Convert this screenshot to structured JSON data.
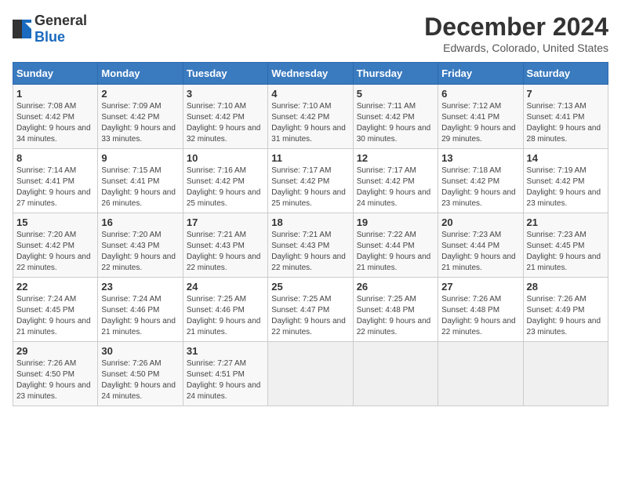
{
  "logo": {
    "text_general": "General",
    "text_blue": "Blue"
  },
  "title": "December 2024",
  "subtitle": "Edwards, Colorado, United States",
  "days_of_week": [
    "Sunday",
    "Monday",
    "Tuesday",
    "Wednesday",
    "Thursday",
    "Friday",
    "Saturday"
  ],
  "weeks": [
    [
      {
        "day": "1",
        "sunrise": "Sunrise: 7:08 AM",
        "sunset": "Sunset: 4:42 PM",
        "daylight": "Daylight: 9 hours and 34 minutes."
      },
      {
        "day": "2",
        "sunrise": "Sunrise: 7:09 AM",
        "sunset": "Sunset: 4:42 PM",
        "daylight": "Daylight: 9 hours and 33 minutes."
      },
      {
        "day": "3",
        "sunrise": "Sunrise: 7:10 AM",
        "sunset": "Sunset: 4:42 PM",
        "daylight": "Daylight: 9 hours and 32 minutes."
      },
      {
        "day": "4",
        "sunrise": "Sunrise: 7:10 AM",
        "sunset": "Sunset: 4:42 PM",
        "daylight": "Daylight: 9 hours and 31 minutes."
      },
      {
        "day": "5",
        "sunrise": "Sunrise: 7:11 AM",
        "sunset": "Sunset: 4:42 PM",
        "daylight": "Daylight: 9 hours and 30 minutes."
      },
      {
        "day": "6",
        "sunrise": "Sunrise: 7:12 AM",
        "sunset": "Sunset: 4:41 PM",
        "daylight": "Daylight: 9 hours and 29 minutes."
      },
      {
        "day": "7",
        "sunrise": "Sunrise: 7:13 AM",
        "sunset": "Sunset: 4:41 PM",
        "daylight": "Daylight: 9 hours and 28 minutes."
      }
    ],
    [
      {
        "day": "8",
        "sunrise": "Sunrise: 7:14 AM",
        "sunset": "Sunset: 4:41 PM",
        "daylight": "Daylight: 9 hours and 27 minutes."
      },
      {
        "day": "9",
        "sunrise": "Sunrise: 7:15 AM",
        "sunset": "Sunset: 4:41 PM",
        "daylight": "Daylight: 9 hours and 26 minutes."
      },
      {
        "day": "10",
        "sunrise": "Sunrise: 7:16 AM",
        "sunset": "Sunset: 4:42 PM",
        "daylight": "Daylight: 9 hours and 25 minutes."
      },
      {
        "day": "11",
        "sunrise": "Sunrise: 7:17 AM",
        "sunset": "Sunset: 4:42 PM",
        "daylight": "Daylight: 9 hours and 25 minutes."
      },
      {
        "day": "12",
        "sunrise": "Sunrise: 7:17 AM",
        "sunset": "Sunset: 4:42 PM",
        "daylight": "Daylight: 9 hours and 24 minutes."
      },
      {
        "day": "13",
        "sunrise": "Sunrise: 7:18 AM",
        "sunset": "Sunset: 4:42 PM",
        "daylight": "Daylight: 9 hours and 23 minutes."
      },
      {
        "day": "14",
        "sunrise": "Sunrise: 7:19 AM",
        "sunset": "Sunset: 4:42 PM",
        "daylight": "Daylight: 9 hours and 23 minutes."
      }
    ],
    [
      {
        "day": "15",
        "sunrise": "Sunrise: 7:20 AM",
        "sunset": "Sunset: 4:42 PM",
        "daylight": "Daylight: 9 hours and 22 minutes."
      },
      {
        "day": "16",
        "sunrise": "Sunrise: 7:20 AM",
        "sunset": "Sunset: 4:43 PM",
        "daylight": "Daylight: 9 hours and 22 minutes."
      },
      {
        "day": "17",
        "sunrise": "Sunrise: 7:21 AM",
        "sunset": "Sunset: 4:43 PM",
        "daylight": "Daylight: 9 hours and 22 minutes."
      },
      {
        "day": "18",
        "sunrise": "Sunrise: 7:21 AM",
        "sunset": "Sunset: 4:43 PM",
        "daylight": "Daylight: 9 hours and 22 minutes."
      },
      {
        "day": "19",
        "sunrise": "Sunrise: 7:22 AM",
        "sunset": "Sunset: 4:44 PM",
        "daylight": "Daylight: 9 hours and 21 minutes."
      },
      {
        "day": "20",
        "sunrise": "Sunrise: 7:23 AM",
        "sunset": "Sunset: 4:44 PM",
        "daylight": "Daylight: 9 hours and 21 minutes."
      },
      {
        "day": "21",
        "sunrise": "Sunrise: 7:23 AM",
        "sunset": "Sunset: 4:45 PM",
        "daylight": "Daylight: 9 hours and 21 minutes."
      }
    ],
    [
      {
        "day": "22",
        "sunrise": "Sunrise: 7:24 AM",
        "sunset": "Sunset: 4:45 PM",
        "daylight": "Daylight: 9 hours and 21 minutes."
      },
      {
        "day": "23",
        "sunrise": "Sunrise: 7:24 AM",
        "sunset": "Sunset: 4:46 PM",
        "daylight": "Daylight: 9 hours and 21 minutes."
      },
      {
        "day": "24",
        "sunrise": "Sunrise: 7:25 AM",
        "sunset": "Sunset: 4:46 PM",
        "daylight": "Daylight: 9 hours and 21 minutes."
      },
      {
        "day": "25",
        "sunrise": "Sunrise: 7:25 AM",
        "sunset": "Sunset: 4:47 PM",
        "daylight": "Daylight: 9 hours and 22 minutes."
      },
      {
        "day": "26",
        "sunrise": "Sunrise: 7:25 AM",
        "sunset": "Sunset: 4:48 PM",
        "daylight": "Daylight: 9 hours and 22 minutes."
      },
      {
        "day": "27",
        "sunrise": "Sunrise: 7:26 AM",
        "sunset": "Sunset: 4:48 PM",
        "daylight": "Daylight: 9 hours and 22 minutes."
      },
      {
        "day": "28",
        "sunrise": "Sunrise: 7:26 AM",
        "sunset": "Sunset: 4:49 PM",
        "daylight": "Daylight: 9 hours and 23 minutes."
      }
    ],
    [
      {
        "day": "29",
        "sunrise": "Sunrise: 7:26 AM",
        "sunset": "Sunset: 4:50 PM",
        "daylight": "Daylight: 9 hours and 23 minutes."
      },
      {
        "day": "30",
        "sunrise": "Sunrise: 7:26 AM",
        "sunset": "Sunset: 4:50 PM",
        "daylight": "Daylight: 9 hours and 24 minutes."
      },
      {
        "day": "31",
        "sunrise": "Sunrise: 7:27 AM",
        "sunset": "Sunset: 4:51 PM",
        "daylight": "Daylight: 9 hours and 24 minutes."
      },
      null,
      null,
      null,
      null
    ]
  ]
}
